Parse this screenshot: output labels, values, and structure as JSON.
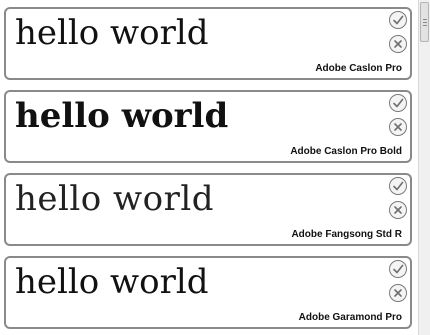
{
  "sample_text": "hello world",
  "fonts": [
    {
      "name": "Adobe Caslon Pro",
      "style": "regular"
    },
    {
      "name": "Adobe Caslon Pro Bold",
      "style": "bold"
    },
    {
      "name": "Adobe Fangsong Std R",
      "style": "light"
    },
    {
      "name": "Adobe Garamond Pro",
      "style": "regular"
    }
  ],
  "icons": {
    "accept": "check-circle-icon",
    "reject": "x-circle-icon"
  },
  "colors": {
    "card_border": "#8a8a8a",
    "icon_stroke": "#6f6f6f",
    "text": "#111111"
  }
}
